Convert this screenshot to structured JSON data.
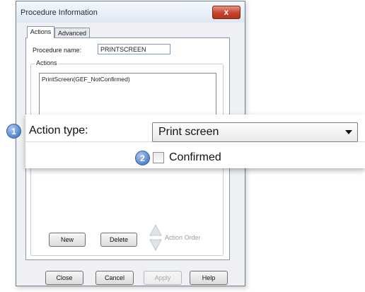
{
  "dialog": {
    "title": "Procedure Information",
    "close_label": "x"
  },
  "tabs": [
    {
      "label": "Actions",
      "active": true
    },
    {
      "label": "Advanced",
      "active": false
    }
  ],
  "procedure": {
    "name_label": "Procedure name:",
    "name_value": "PRINTSCREEN"
  },
  "actions_group": {
    "legend": "Actions",
    "items": [
      "PrintScreen(GEF_NotConfirmed)"
    ]
  },
  "action_buttons": {
    "new_label": "New",
    "delete_label": "Delete",
    "order_label": "Action Order"
  },
  "footer": {
    "close_label": "Close",
    "cancel_label": "Cancel",
    "apply_label": "Apply",
    "help_label": "Help"
  },
  "callout": {
    "badge1": "1",
    "action_type_label": "Action type:",
    "action_type_value": "Print screen",
    "badge2": "2",
    "confirmed_label": "Confirmed",
    "confirmed_checked": false
  },
  "colors": {
    "badge_blue": "#5f8fd3",
    "close_red": "#c4432a"
  }
}
